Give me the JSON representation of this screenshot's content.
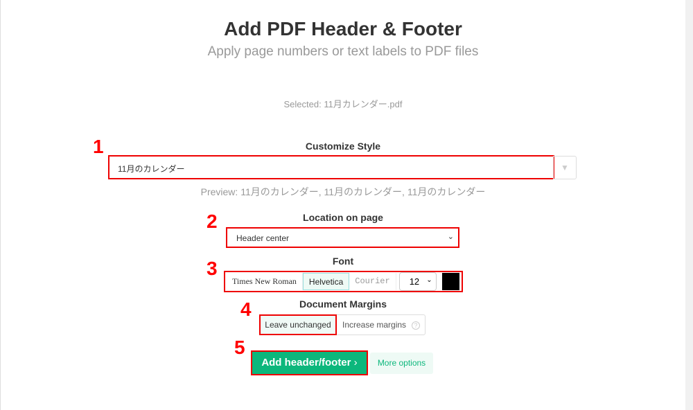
{
  "header": {
    "title": "Add PDF Header & Footer",
    "subtitle": "Apply page numbers or text labels to PDF files"
  },
  "selected": "Selected: 11月カレンダー.pdf",
  "steps": [
    "1",
    "2",
    "3",
    "4",
    "5"
  ],
  "style": {
    "label": "Customize Style",
    "value": "11月のカレンダー",
    "preview": "Preview: 11月のカレンダー, 11月のカレンダー, 11月のカレンダー"
  },
  "location": {
    "label": "Location on page",
    "value": "Header center"
  },
  "font": {
    "label": "Font",
    "options": [
      "Times New Roman",
      "Helvetica",
      "Courier"
    ],
    "selected": "Helvetica",
    "size": "12",
    "color": "#000000"
  },
  "margins": {
    "label": "Document Margins",
    "options": [
      "Leave unchanged",
      "Increase margins"
    ],
    "selected": "Leave unchanged",
    "help": "?"
  },
  "actions": {
    "add": "Add header/footer",
    "more": "More options"
  },
  "colors": {
    "accent": "#0cb77c",
    "highlight": "#e00000"
  }
}
